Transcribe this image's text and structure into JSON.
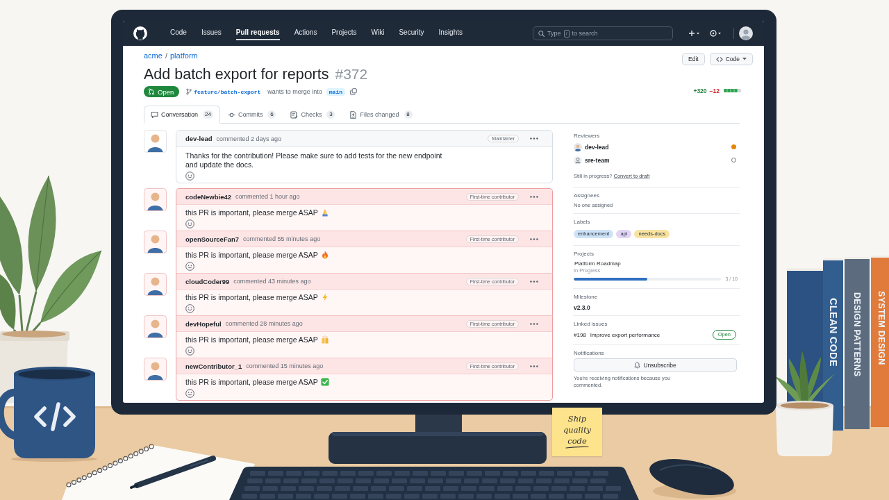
{
  "scene": {
    "sticky_note": "Ship quality code",
    "books": [
      {
        "title": "CLEAN CODE",
        "color": "#315e8f"
      },
      {
        "title": "DESIGN PATTERNS",
        "color": "#5c6c7e"
      },
      {
        "title": "SYSTEM DESIGN",
        "color": "#e17b3b"
      }
    ]
  },
  "nav": {
    "items": [
      {
        "label": "Code",
        "selected": false
      },
      {
        "label": "Issues",
        "selected": false
      },
      {
        "label": "Pull requests",
        "selected": true
      },
      {
        "label": "Actions",
        "selected": false
      },
      {
        "label": "Projects",
        "selected": false
      },
      {
        "label": "Wiki",
        "selected": false
      },
      {
        "label": "Security",
        "selected": false
      },
      {
        "label": "Insights",
        "selected": false
      }
    ],
    "search": {
      "hint_start": "Type",
      "shortcut_key": "/",
      "hint_end": "to search"
    }
  },
  "repo": {
    "owner": "acme",
    "separator": "/",
    "name": "platform"
  },
  "actions": [
    {
      "label": "Edit",
      "kind": "button"
    },
    {
      "label": "Code",
      "kind": "dropdown"
    }
  ],
  "pr": {
    "title": "Add batch export for reports",
    "number": "#372",
    "state": {
      "label": "Open",
      "kind": "open"
    },
    "head_branch": "feature/batch-export",
    "merge_text": "wants to merge into",
    "base_branch": "main",
    "diffstat": {
      "additions": "+320",
      "deletions": "−12",
      "level": 0.8
    }
  },
  "tabs": [
    {
      "label": "Conversation",
      "count": "24",
      "kind": "conversation",
      "selected": true
    },
    {
      "label": "Commits",
      "count": "6",
      "kind": "commits",
      "selected": false
    },
    {
      "label": "Checks",
      "count": "3",
      "kind": "checks",
      "selected": false
    },
    {
      "label": "Files changed",
      "count": "8",
      "kind": "files",
      "selected": false
    }
  ],
  "timeline": [
    {
      "author": "dev-lead",
      "action": "commented 2 days ago",
      "role": "Maintainer",
      "text": "Thanks for the contribution! Please make sure to add tests for the new endpoint and update the docs.",
      "highlighted": false
    },
    {
      "author": "codeNewbie42",
      "action": "commented 1 hour ago",
      "role": "First-time contributor",
      "text": "this PR is important, please merge ASAP",
      "emoji": {
        "kind": "folded-hands"
      },
      "highlighted": true
    },
    {
      "author": "openSourceFan7",
      "action": "commented 55 minutes ago",
      "role": "First-time contributor",
      "text": "this PR is important, please merge ASAP",
      "emoji": {
        "kind": "fire"
      },
      "highlighted": true
    },
    {
      "author": "cloudCoder99",
      "action": "commented 43 minutes ago",
      "role": "First-time contributor",
      "text": "this PR is important, please merge ASAP",
      "emoji": {
        "kind": "lightning"
      },
      "highlighted": true
    },
    {
      "author": "devHopeful",
      "action": "commented 28 minutes ago",
      "role": "First-time contributor",
      "text": "this PR is important, please merge ASAP",
      "emoji": {
        "kind": "raised-hands"
      },
      "highlighted": true
    },
    {
      "author": "newContributor_1",
      "action": "commented 15 minutes ago",
      "role": "First-time contributor",
      "text": "this PR is important, please merge ASAP",
      "emoji": {
        "kind": "check"
      },
      "highlighted": true
    }
  ],
  "sidebar": {
    "reviewers": {
      "heading": "Reviewers",
      "items": [
        {
          "name": "dev-lead",
          "kind": "user",
          "awaiting": true
        },
        {
          "name": "sre-team",
          "kind": "team",
          "awaiting": false
        }
      ],
      "draft_prompt": {
        "text": "Still in progress?",
        "link": "Convert to draft"
      }
    },
    "assignees": {
      "heading": "Assignees",
      "text": "No one assigned"
    },
    "labels": {
      "heading": "Labels",
      "items": [
        {
          "name": "enhancement",
          "color": "#cfe3f7"
        },
        {
          "name": "api",
          "color": "#e3d4f4"
        },
        {
          "name": "needs-docs",
          "color": "#f9e3a1"
        }
      ]
    },
    "projects": {
      "heading": "Projects",
      "name": "Platform Roadmap",
      "status": "In Progress",
      "level": 0.5,
      "progress_text": "3 / 10"
    },
    "milestone": {
      "heading": "Milestone",
      "name": "v2.3.0"
    },
    "linked_issues": {
      "heading": "Linked issues",
      "items": [
        {
          "number": "#198",
          "title": "Improve export performance",
          "state": "Open",
          "kind": "open"
        }
      ]
    },
    "notifications": {
      "heading": "Notifications",
      "button": "Unsubscribe",
      "note": "You're receiving notifications because you commented."
    }
  }
}
